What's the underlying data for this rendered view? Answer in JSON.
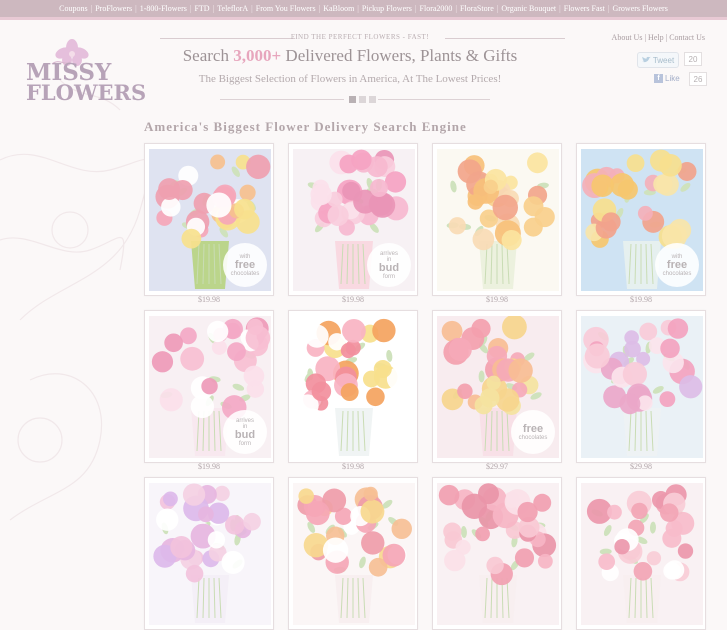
{
  "topnav": {
    "links": [
      "Coupons",
      "ProFlowers",
      "1-800-Flowers",
      "FTD",
      "TeleflorA",
      "From You Flowers",
      "KaBloom",
      "Pickup Flowers",
      "Flora2000",
      "FloraStore",
      "Organic Bouquet",
      "Flowers Fast",
      "Growers Flowers"
    ]
  },
  "logo": {
    "line1": "MISSY",
    "line2": "FLOWERS"
  },
  "header": {
    "tagline": "FIND THE PERFECT FLOWERS - FAST!",
    "headline_pre": "Search ",
    "headline_count": "3,000+",
    "headline_post": " Delivered Flowers, Plants & Gifts",
    "subhead": "The Biggest Selection of Flowers in America, At The Lowest Prices!"
  },
  "toplinks": {
    "about": "About Us",
    "help": "Help",
    "contact": "Contact Us"
  },
  "social": {
    "tweet_label": "Tweet",
    "tweet_count": "20",
    "like_label": "Like",
    "like_count": "26"
  },
  "section_title": "America's Biggest Flower Delivery Search Engine",
  "colors": {
    "accent_pink": "#e7a6bd",
    "topbar": "#cdb8bf"
  },
  "products": [
    {
      "price": "$19.98",
      "badge": [
        "with",
        "free",
        "chocolates"
      ],
      "palette": [
        "#ef9fb0",
        "#f6c08e",
        "#f7e18d",
        "#f5a6b8",
        "#ffffff"
      ],
      "vase": "#b7d37f",
      "bg": "#dfe3f1"
    },
    {
      "price": "$19.98",
      "badge": [
        "arrives",
        "in",
        "bud",
        "form"
      ],
      "palette": [
        "#f6b9cf",
        "#f5a3c2",
        "#fbe1ea",
        "#e995b6",
        "#f9cddc"
      ],
      "vase": "#f8d6df",
      "bg": "#f7f1f4"
    },
    {
      "price": "$19.98",
      "badge": null,
      "palette": [
        "#f9cf8c",
        "#f7c07a",
        "#fbe4a0",
        "#f2a58b",
        "#f9dbb5"
      ],
      "vase": "#eaf0dc",
      "bg": "#fbf9f2"
    },
    {
      "price": "$19.98",
      "badge": [
        "with",
        "free",
        "chocolates"
      ],
      "palette": [
        "#f6c76f",
        "#f2a38c",
        "#f7df8e",
        "#f4b0ba",
        "#f9e5a9"
      ],
      "vase": "#e8f1ee",
      "bg": "#cfe3f3"
    },
    {
      "price": "$19.98",
      "badge": [
        "arrives",
        "in",
        "bud",
        "form"
      ],
      "palette": [
        "#f3a8c5",
        "#f7bfd3",
        "#fbe0ea",
        "#ee9ab9",
        "#ffffff"
      ],
      "vase": "#f7e7ee",
      "bg": "#f8f0f3"
    },
    {
      "price": "$19.98",
      "badge": null,
      "palette": [
        "#f28f9d",
        "#f7e08c",
        "#f8b3c2",
        "#f4a35e",
        "#ffffff"
      ],
      "vase": "#eef3f3",
      "bg": "#ffffff"
    },
    {
      "price": "$29.97",
      "badge": [
        "free",
        "chocolates"
      ],
      "palette": [
        "#f5a9b8",
        "#f6d58d",
        "#f7bd94",
        "#f4e3a0",
        "#f39fae"
      ],
      "vase": "#f7dfe6",
      "bg": "#f8ecef"
    },
    {
      "price": "$29.98",
      "badge": null,
      "palette": [
        "#f3a3bf",
        "#dcbde6",
        "#f8cbd8",
        "#eaa7c9",
        "#fbe4ec"
      ],
      "vase": "#eef2f4",
      "bg": "#eaf1f6"
    },
    {
      "price": "",
      "badge": null,
      "palette": [
        "#e6b5e0",
        "#f2c2dc",
        "#dcb9ea",
        "#f4d0e3",
        "#ffffff"
      ],
      "vase": "#f3eef6",
      "bg": "#f8f5fa"
    },
    {
      "price": "",
      "badge": null,
      "palette": [
        "#f5a6b6",
        "#f7d88e",
        "#f6bf95",
        "#ef9ca9",
        "#ffffff"
      ],
      "vase": "#f7eef0",
      "bg": "#fbf6f6"
    },
    {
      "price": "",
      "badge": null,
      "palette": [
        "#f19fb1",
        "#f8c9d4",
        "#f6b5c4",
        "#e995a8",
        "#fbe1e8"
      ],
      "vase": "#f7eef0",
      "bg": "#f9f1f3"
    },
    {
      "price": "",
      "badge": null,
      "palette": [
        "#f2a5b5",
        "#f9cdd7",
        "#ec97ab",
        "#f7bccb",
        "#ffffff"
      ],
      "vase": "#f7eef0",
      "bg": "#f9f1f3"
    }
  ]
}
